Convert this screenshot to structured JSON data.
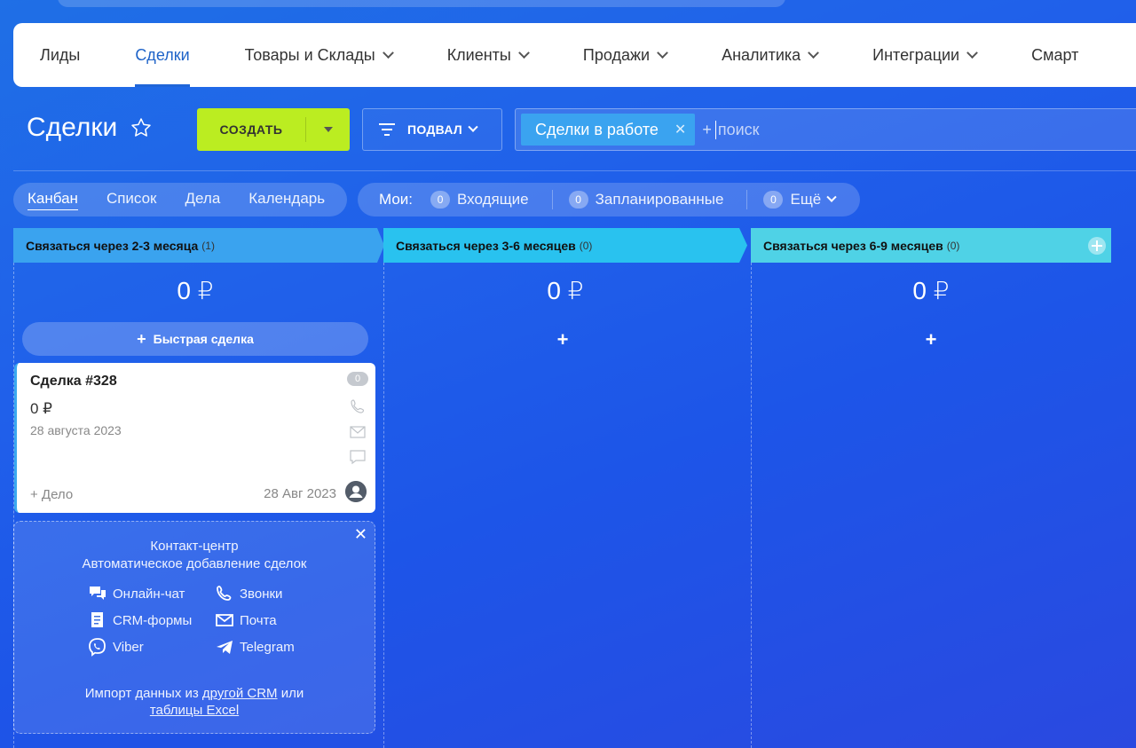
{
  "nav": {
    "items": [
      {
        "label": "Лиды",
        "dropdown": false,
        "active": false
      },
      {
        "label": "Сделки",
        "dropdown": false,
        "active": true
      },
      {
        "label": "Товары и Склады",
        "dropdown": true,
        "active": false
      },
      {
        "label": "Клиенты",
        "dropdown": true,
        "active": false
      },
      {
        "label": "Продажи",
        "dropdown": true,
        "active": false
      },
      {
        "label": "Аналитика",
        "dropdown": true,
        "active": false
      },
      {
        "label": "Интеграции",
        "dropdown": true,
        "active": false
      },
      {
        "label": "Смарт",
        "dropdown": false,
        "active": false
      }
    ]
  },
  "toolbar": {
    "title": "Сделки",
    "create_label": "СОЗДАТЬ",
    "filter_label": "ПОДВАЛ",
    "filter_chip": "Сделки в работе",
    "search_plus": "+",
    "search_placeholder": "поиск"
  },
  "view_tabs": [
    "Канбан",
    "Список",
    "Дела",
    "Календарь"
  ],
  "my": {
    "label": "Мои:",
    "incoming": {
      "count": "0",
      "label": "Входящие"
    },
    "planned": {
      "count": "0",
      "label": "Запланированные"
    },
    "more": {
      "count": "0",
      "label": "Ещё"
    }
  },
  "columns": [
    {
      "title": "Связаться через 2-3 месяца",
      "count": "(1)",
      "sum": "0 ₽",
      "color": "#3aa3ef"
    },
    {
      "title": "Связаться через 3-6 месяцев",
      "count": "(0)",
      "sum": "0 ₽",
      "color": "#29c2ef",
      "plus": "+"
    },
    {
      "title": "Связаться через 6-9 месяцев",
      "count": "(0)",
      "sum": "0 ₽",
      "color": "#4fd2e6",
      "plus": "+"
    }
  ],
  "quick_deal": "Быстрая сделка",
  "deal": {
    "title": "Сделка #328",
    "sum": "0 ₽",
    "date": "28 августа 2023",
    "badge": "0",
    "add_task": "+ Дело",
    "date_short": "28 Авг 2023"
  },
  "contact_center": {
    "title": "Контакт-центр",
    "subtitle": "Автоматическое добавление сделок",
    "channels": {
      "online_chat": "Онлайн-чат",
      "calls": "Звонки",
      "crm_forms": "CRM-формы",
      "mail": "Почта",
      "viber": "Viber",
      "telegram": "Telegram"
    },
    "import_prefix": "Импорт данных из",
    "import_link1": "другой CRM",
    "import_mid": "или",
    "import_link2": "таблицы Excel"
  }
}
